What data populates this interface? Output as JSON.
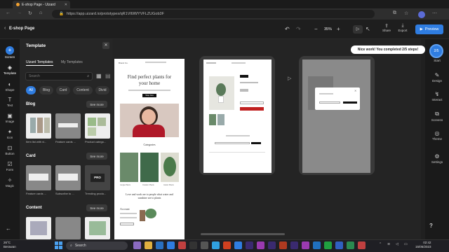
{
  "browser": {
    "tab_title": "E-shop Page - Uizard",
    "url": "https://app.uizard.io/prototypes/qR1Vl6lWYVFLZUGob3F"
  },
  "header": {
    "project_name": "E-shop Page",
    "zoom": "35%",
    "share_label": "Share",
    "export_label": "Export",
    "preview_label": "Preview"
  },
  "left_tools": [
    {
      "label": "Screen",
      "icon": "plus-icon"
    },
    {
      "label": "Template",
      "icon": "layers-icon"
    },
    {
      "label": "Shape",
      "icon": "shape-icon"
    },
    {
      "label": "Text",
      "icon": "text-icon"
    },
    {
      "label": "Image",
      "icon": "image-icon"
    },
    {
      "label": "Icon",
      "icon": "icon-icon"
    },
    {
      "label": "Button",
      "icon": "button-icon"
    },
    {
      "label": "Form",
      "icon": "form-icon"
    },
    {
      "label": "Magic",
      "icon": "magic-icon"
    }
  ],
  "panel": {
    "title": "Template",
    "tabs": [
      "Uizard Templates",
      "My Templates"
    ],
    "search_placeholder": "Search",
    "chips": [
      "All",
      "Blog",
      "Card",
      "Content",
      "Divid"
    ],
    "sections": [
      {
        "name": "Blog",
        "see_more": "See more",
        "captions": [
          "Item list with vi...",
          "Feature cards ...",
          "Product catego..."
        ]
      },
      {
        "name": "Card",
        "see_more": "See more",
        "captions": [
          "Feature cards ...",
          "Subscribe to ...",
          "Trending produ..."
        ]
      },
      {
        "name": "Content",
        "see_more": "See more"
      }
    ],
    "pro_badge": "PRO"
  },
  "canvas": {
    "toast": "Nice work! You completed 2/5 steps!",
    "page1": {
      "brand": "Brand Co.",
      "headline": "Find perfect plants for your home",
      "button": "Shop Now",
      "categories_title": "Categories",
      "category_labels": [
        "Jungle Plants",
        "Outdoor Plants",
        "Indoor Plants"
      ],
      "quote": "Love and work are to people what water and sunshine are to plants",
      "account_title": "Account"
    }
  },
  "right_rail": {
    "progress": "2/5",
    "items": [
      "Start",
      "Design",
      "Interact",
      "Screens",
      "Theme",
      "Settings"
    ]
  },
  "taskbar": {
    "temperature": "26°C",
    "weather": "Berawan",
    "search": "Search",
    "time": "02:42",
    "date": "15/05/2023"
  }
}
